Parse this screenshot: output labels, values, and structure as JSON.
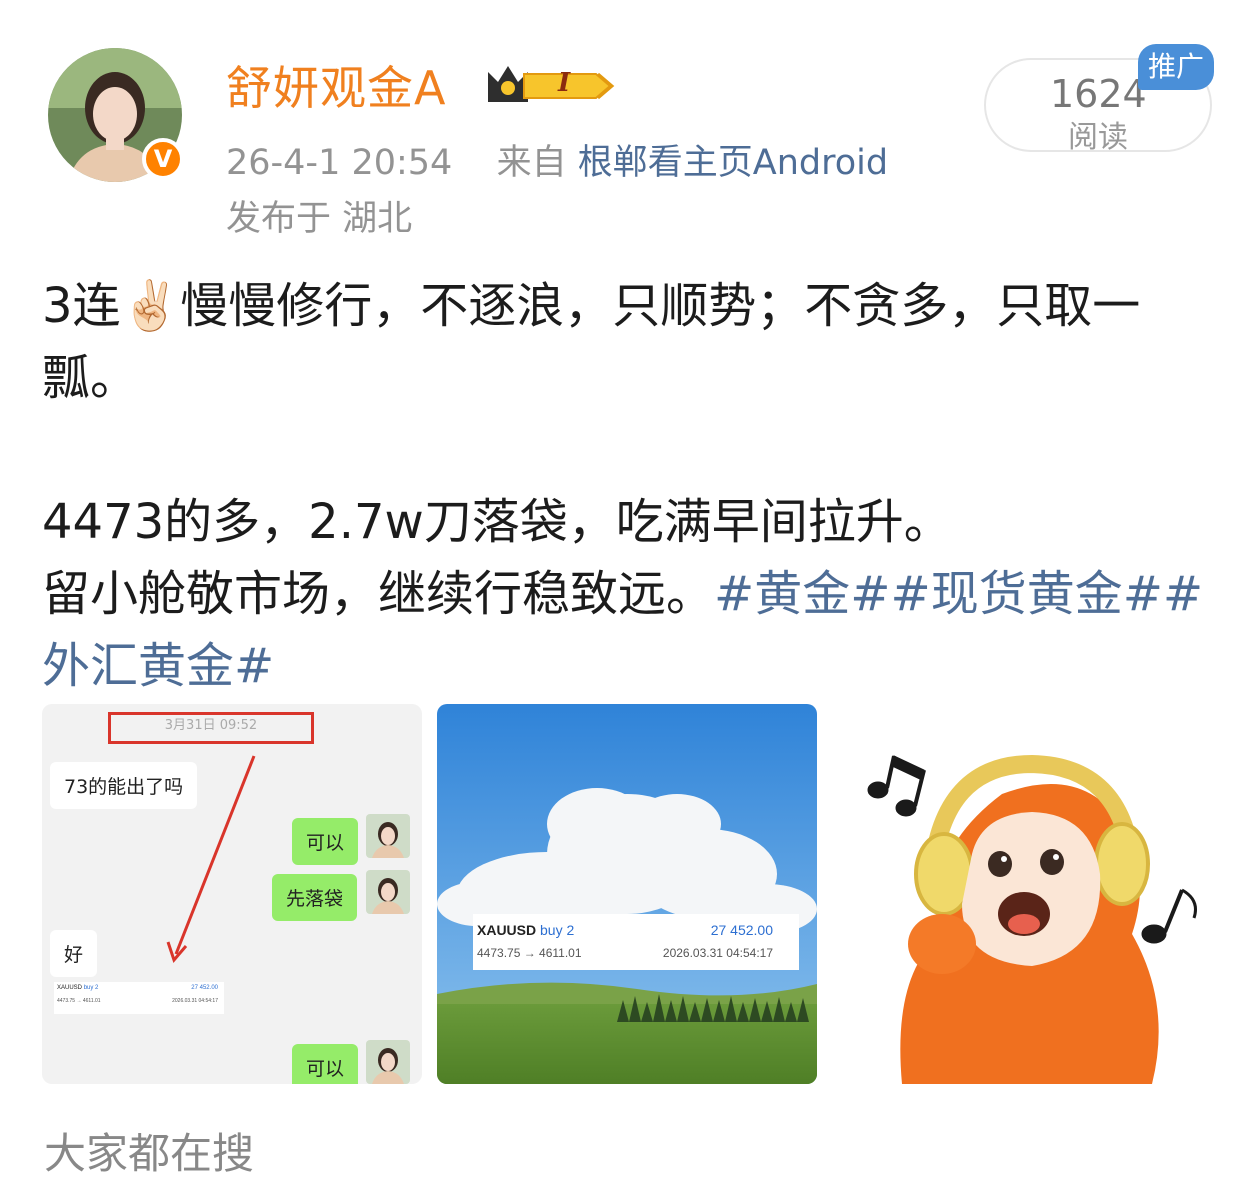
{
  "header": {
    "username": "舒妍观金A",
    "level_badge": "I",
    "timestamp": "26-4-1 20:54",
    "from_prefix": "来自",
    "source": "根郸看主页Android",
    "location": "发布于 湖北",
    "read_count": "1624",
    "read_label": "阅读",
    "promo_tag": "推广",
    "verified_mark": "V"
  },
  "post": {
    "line1": "3连✌🏻慢慢修行，不逐浪，只顺势；不贪多，只取一瓢。",
    "line2": "4473的多，2.7w刀落袋，吃满早间拉升。",
    "line3_text": "留小舱敬市场，继续行稳致远。",
    "topics": [
      "#黄金#",
      "#现货黄金#",
      "#外汇黄金#"
    ]
  },
  "image1": {
    "header_text": "3月31日 09:52",
    "messages": [
      {
        "side": "left",
        "text": "73的能出了吗"
      },
      {
        "side": "right",
        "text": "可以"
      },
      {
        "side": "right",
        "text": "先落袋"
      },
      {
        "side": "left",
        "text": "好"
      },
      {
        "side": "right",
        "text": "可以"
      }
    ],
    "mini_card": {
      "symbol": "XAUUSD",
      "dir": "buy 2",
      "prices": "4473.75 → 4611.01",
      "profit": "27 452.00",
      "time": "2026.03.31 04:54:17"
    }
  },
  "image2": {
    "symbol": "XAUUSD",
    "direction": "buy 2",
    "prices": "4473.75 → 4611.01",
    "profit": "27 452.00",
    "time": "2026.03.31 04:54:17"
  },
  "footer": {
    "search_label": "大家都在搜"
  },
  "colors": {
    "username": "#f0801f",
    "link": "#4e6d96",
    "promo": "#4a8fd8",
    "verified": "#ff8200"
  }
}
